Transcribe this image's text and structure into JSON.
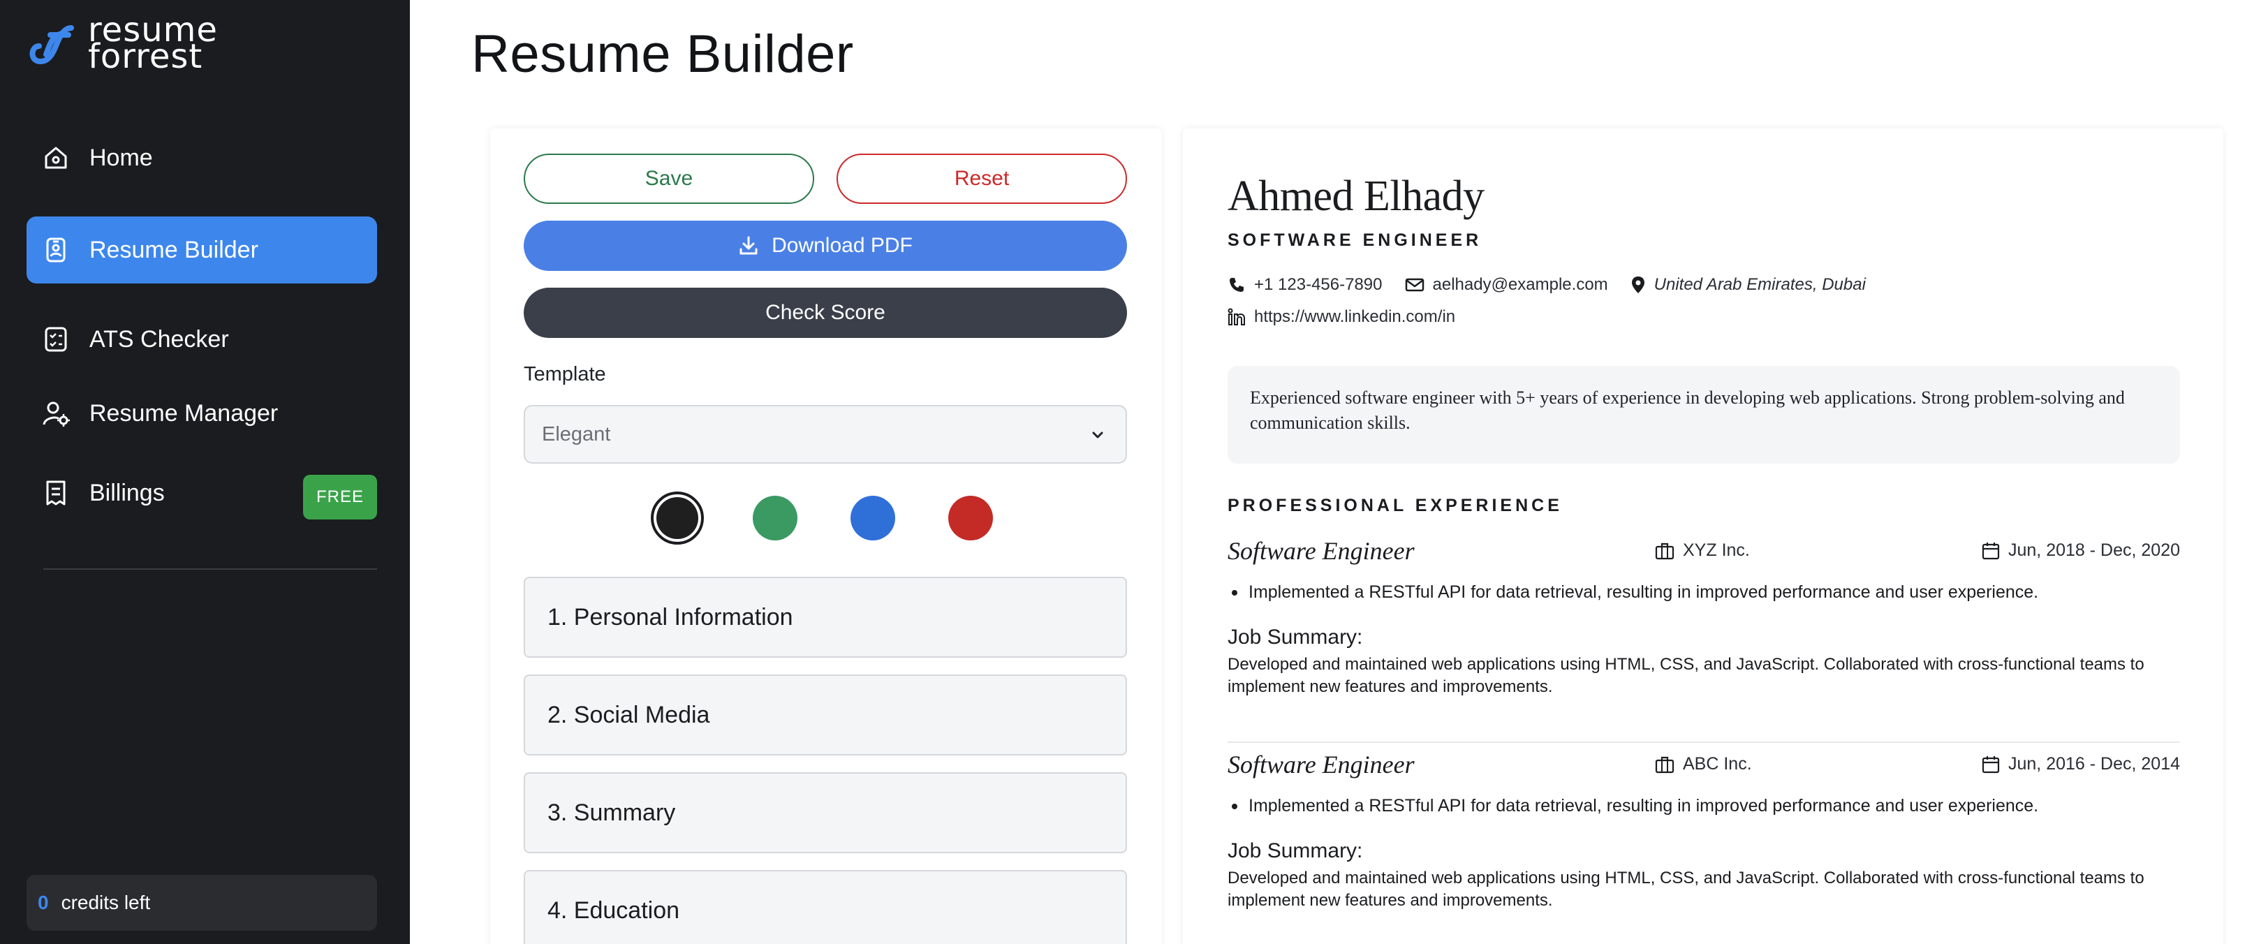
{
  "brand": {
    "name_line1": "resume",
    "name_line2": "forrest",
    "accent": "#3d87ec"
  },
  "sidebar": {
    "items": [
      {
        "label": "Home",
        "icon": "home-icon"
      },
      {
        "label": "Resume Builder",
        "icon": "badge-icon",
        "active": true
      },
      {
        "label": "ATS Checker",
        "icon": "checklist-icon"
      },
      {
        "label": "Resume Manager",
        "icon": "user-gear-icon"
      },
      {
        "label": "Billings",
        "icon": "receipt-icon",
        "badge": "FREE"
      }
    ],
    "credits_count": "0",
    "credits_label": "credits left"
  },
  "page": {
    "title": "Resume Builder"
  },
  "editor": {
    "save_label": "Save",
    "reset_label": "Reset",
    "download_label": "Download PDF",
    "score_label": "Check Score",
    "template_label": "Template",
    "template_value": "Elegant",
    "colors": [
      "#1f1f1f",
      "#3a9a62",
      "#2f6fd8",
      "#c42a26"
    ],
    "selected_color": "#1f1f1f",
    "sections": [
      "1. Personal Information",
      "2. Social Media",
      "3. Summary",
      "4. Education"
    ]
  },
  "resume": {
    "name": "Ahmed Elhady",
    "role": "SOFTWARE ENGINEER",
    "phone": "+1 123-456-7890",
    "email": "aelhady@example.com",
    "location": "United Arab Emirates, Dubai",
    "linkedin": "https://www.linkedin.com/in",
    "summary": "Experienced software engineer with 5+ years of experience in developing web applications. Strong problem-solving and communication skills.",
    "experience_heading": "PROFESSIONAL EXPERIENCE",
    "jobs": [
      {
        "title": "Software Engineer",
        "company": "XYZ Inc.",
        "dates": "Jun, 2018 - Dec, 2020",
        "bullet": "Implemented a RESTful API for data retrieval, resulting in improved performance and user experience.",
        "summary_label": "Job Summary:",
        "summary": "Developed and maintained web applications using HTML, CSS, and JavaScript. Collaborated with cross-functional teams to implement new features and improvements."
      },
      {
        "title": "Software Engineer",
        "company": "ABC Inc.",
        "dates": "Jun, 2016 - Dec, 2014",
        "bullet": "Implemented a RESTful API for data retrieval, resulting in improved performance and user experience.",
        "summary_label": "Job Summary:",
        "summary": "Developed and maintained web applications using HTML, CSS, and JavaScript. Collaborated with cross-functional teams to implement new features and improvements."
      }
    ]
  }
}
